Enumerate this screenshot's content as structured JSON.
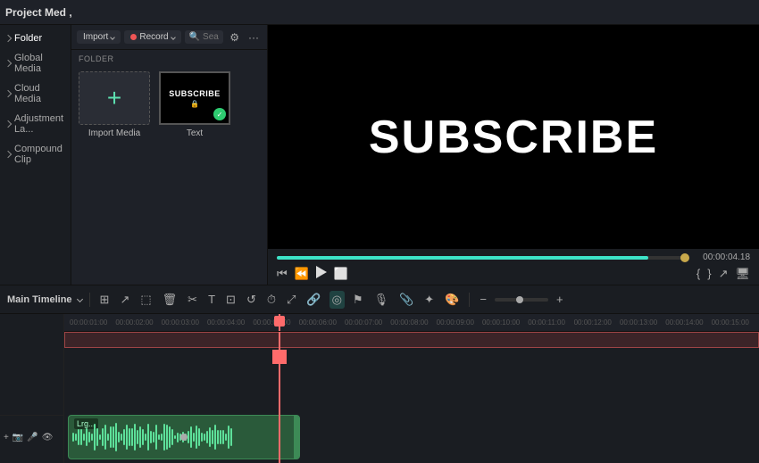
{
  "app": {
    "title": "Project Med ,"
  },
  "sidebar": {
    "items": [
      {
        "id": "folder",
        "label": "Folder"
      },
      {
        "id": "global-media",
        "label": "Global Media"
      },
      {
        "id": "cloud-media",
        "label": "Cloud Media"
      },
      {
        "id": "adjustment-layer",
        "label": "Adjustment La..."
      },
      {
        "id": "compound-clip",
        "label": "Compound Clip"
      }
    ]
  },
  "media_toolbar": {
    "import_label": "Import",
    "record_label": "Record",
    "search_placeholder": "Search media",
    "section_label": "FOLDER"
  },
  "media_items": [
    {
      "id": "import",
      "type": "import",
      "label": "Import Media"
    },
    {
      "id": "text",
      "type": "subscribe",
      "label": "Text"
    }
  ],
  "preview": {
    "title": "SUBSCRIBE",
    "time_display": "00:00:04.18"
  },
  "timeline": {
    "label": "Main Timeline",
    "time_markers": [
      "00:00:01:00",
      "00:00:02:00",
      "00:00:03:00",
      "00:00:04:00",
      "00:00:05:00",
      "00:00:06:00",
      "00:00:07:00",
      "00:00:08:00",
      "00:00:09:00",
      "00:00:10:00",
      "00:00:11:00",
      "00:00:12:00",
      "00:00:13:00",
      "00:00:14:00",
      "00:00:15:00"
    ],
    "tools": [
      "group",
      "arrow",
      "cut",
      "delete",
      "scissors",
      "text",
      "crop",
      "loop",
      "timer",
      "fit",
      "link",
      "copy",
      "special1",
      "special2",
      "special3",
      "special4",
      "special5",
      "zoom-out",
      "zoom-slider",
      "zoom-in"
    ]
  },
  "colors": {
    "accent_teal": "#3de3c8",
    "playhead_red": "#ff6b6b",
    "audio_green": "#2a5a3a",
    "audio_border": "#3d8a56",
    "waveform": "#5de09a"
  }
}
